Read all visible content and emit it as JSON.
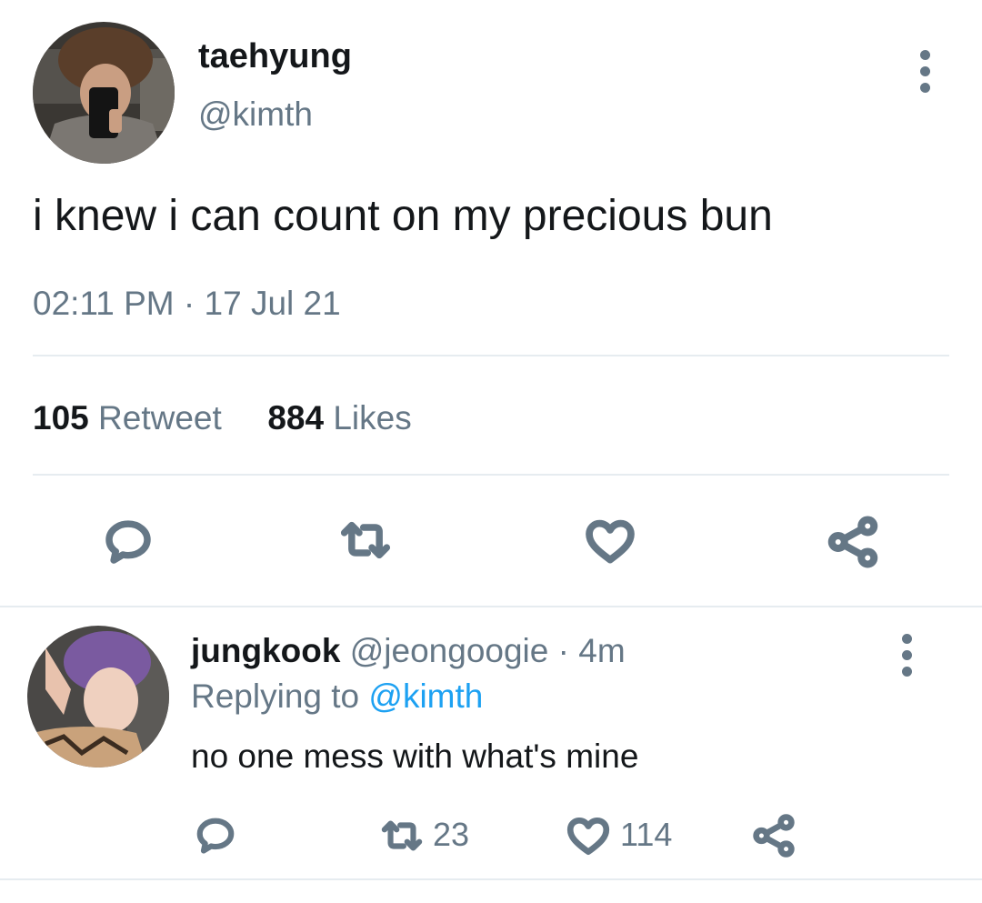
{
  "main_tweet": {
    "author_name": "taehyung",
    "handle": "@kimth",
    "text": "i knew i can count on my precious bun",
    "time": "02:11 PM",
    "separator": "·",
    "date": "17 Jul 21",
    "retweet_count": "105",
    "retweet_label": "Retweet",
    "like_count": "884",
    "like_label": "Likes",
    "more_icon": "more-vertical-icon",
    "actions": [
      "reply-icon",
      "retweet-icon",
      "like-icon",
      "share-icon"
    ]
  },
  "reply": {
    "author_name": "jungkook",
    "handle": "@jeongoogie",
    "separator": "·",
    "time_ago": "4m",
    "replying_to_label": "Replying to",
    "replying_to_handle": "@kimth",
    "text": "no one mess with what's mine",
    "retweet_count": "23",
    "like_count": "114",
    "more_icon": "more-vertical-icon"
  },
  "colors": {
    "text": "#14171a",
    "muted": "#657786",
    "link": "#1da1f2",
    "divider": "#e6ecf0"
  }
}
